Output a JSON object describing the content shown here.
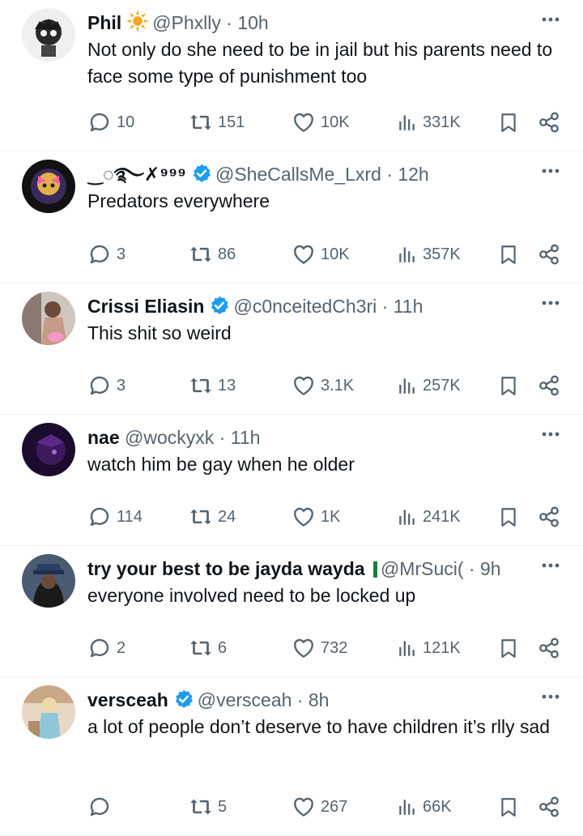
{
  "posts": [
    {
      "name": "Phil",
      "badge": "sun",
      "handle": "@Phxlly",
      "sep": "·",
      "time": "10h",
      "text": "Not only do she need to be in jail but his parents need to face some type of punishment too",
      "replies": "10",
      "reposts": "151",
      "likes": "10K",
      "views": "331K"
    },
    {
      "name": "‿◌࿐✗⁹⁹⁹",
      "badge": "verified",
      "handle": "@SheCallsMe_Lxrd",
      "sep": "·",
      "time": "12h",
      "text": "Predators everywhere",
      "replies": "3",
      "reposts": "86",
      "likes": "10K",
      "views": "357K"
    },
    {
      "name": "Crissi Eliasin",
      "badge": "verified",
      "handle": "@c0nceitedCh3ri",
      "sep": "·",
      "time": "11h",
      "text": "This shit so weird",
      "replies": "3",
      "reposts": "13",
      "likes": "3.1K",
      "views": "257K"
    },
    {
      "name": "nae",
      "badge": "",
      "handle": "@wockyxk",
      "sep": "·",
      "time": "11h",
      "text": "watch him be gay when he older",
      "replies": "114",
      "reposts": "24",
      "likes": "1K",
      "views": "241K"
    },
    {
      "name": "try your best to be jayda wayda",
      "badge": "green-bar",
      "handle": "@MrSuci(",
      "sep": "·",
      "time": "9h",
      "text": "everyone involved need to be locked up",
      "replies": "2",
      "reposts": "6",
      "likes": "732",
      "views": "121K"
    },
    {
      "name": "versceah",
      "badge": "verified",
      "handle": "@versceah",
      "sep": "·",
      "time": "8h",
      "text": "a lot of people don’t deserve to have children it’s rlly sad",
      "replies": "",
      "reposts": "5",
      "likes": "267",
      "views": "66K"
    }
  ],
  "colors": {
    "text": "#0f1419",
    "secondary": "#536471",
    "verified": "#1d9bf0",
    "divider": "#eff3f4",
    "sun": "#f5a623",
    "green_bar": "#1a7f3c"
  },
  "icons": [
    "reply-icon",
    "repost-icon",
    "like-icon",
    "views-icon",
    "bookmark-icon",
    "share-icon",
    "more-icon",
    "verified-icon"
  ]
}
